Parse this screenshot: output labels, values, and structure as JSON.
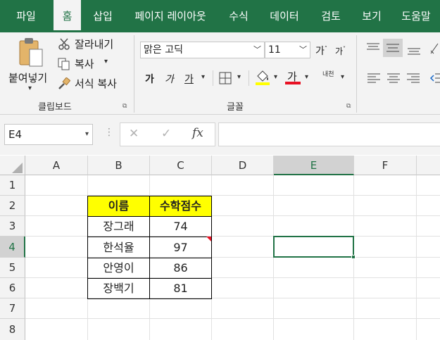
{
  "tabs": [
    "파일",
    "홈",
    "삽입",
    "페이지 레이아웃",
    "수식",
    "데이터",
    "검토",
    "보기",
    "도움말"
  ],
  "clipboard": {
    "paste_label": "붙여넣기",
    "cut_label": "잘라내기",
    "copy_label": "복사",
    "format_painter_label": "서식 복사",
    "group_label": "클립보드"
  },
  "font": {
    "name": "맑은 고딕",
    "size": "11",
    "grow": "가",
    "shrink": "가",
    "bold": "가",
    "italic": "가",
    "underline": "가",
    "font_color_glyph": "가",
    "phonetic": "내천",
    "group_label": "글꼴"
  },
  "formula_bar": {
    "name_box": "E4",
    "cancel": "✕",
    "enter": "✓",
    "fx": "fx",
    "value": ""
  },
  "columns": [
    "A",
    "B",
    "C",
    "D",
    "E",
    "F"
  ],
  "rows": [
    "1",
    "2",
    "3",
    "4",
    "5",
    "6",
    "7",
    "8"
  ],
  "table": {
    "headers": [
      "이름",
      "수학점수"
    ],
    "rows": [
      [
        "장그래",
        "74"
      ],
      [
        "한석율",
        "97"
      ],
      [
        "안영이",
        "86"
      ],
      [
        "장백기",
        "81"
      ]
    ]
  },
  "colors": {
    "excel_green": "#217346",
    "header_fill": "#ffff00",
    "comment_marker": "#e81123"
  }
}
